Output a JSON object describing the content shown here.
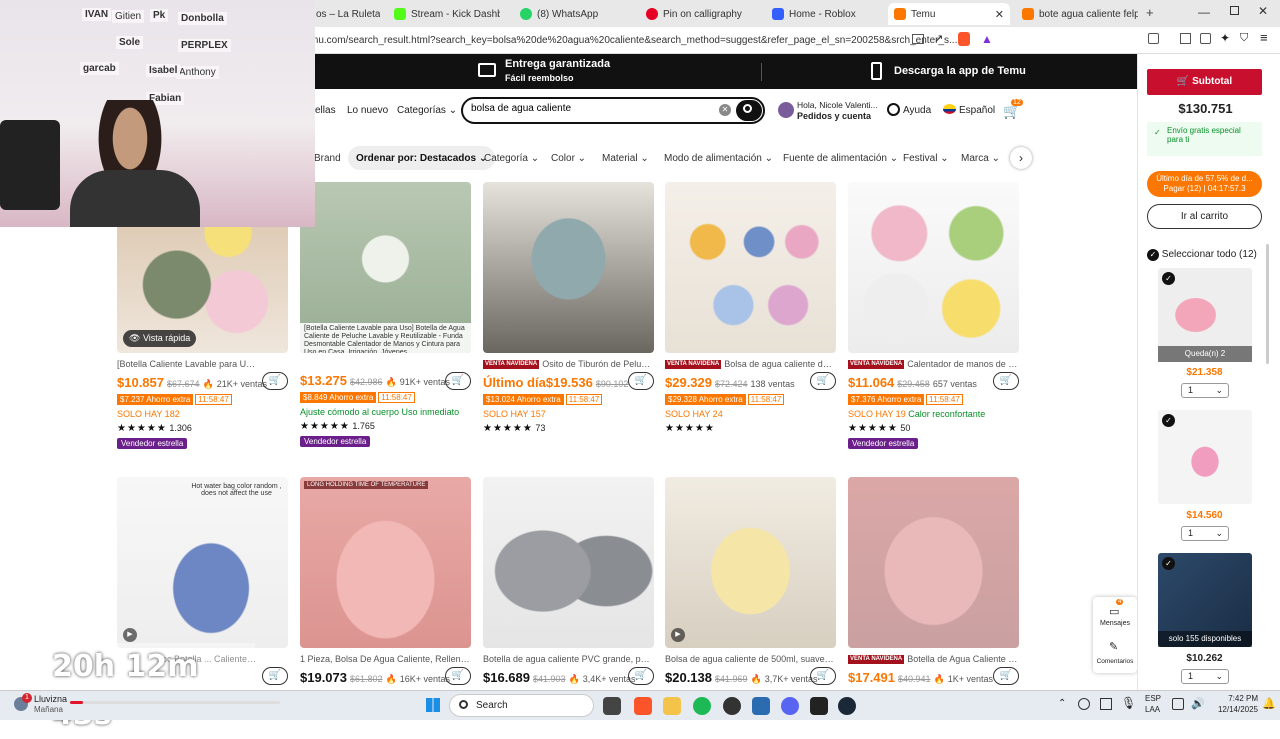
{
  "browser": {
    "tabs": [
      {
        "label": "os – La Ruleta de",
        "color": "#e54"
      },
      {
        "label": "Stream - Kick Dashbo",
        "color": "#53fc18"
      },
      {
        "label": "(8) WhatsApp",
        "color": "#25d366"
      },
      {
        "label": "Pin on calligraphy",
        "color": "#e60023"
      },
      {
        "label": "Home - Roblox",
        "color": "#335fff"
      },
      {
        "label": "Temu",
        "color": "#fb7701"
      },
      {
        "label": "bote agua caliente felpa S",
        "color": "#fb7701"
      }
    ],
    "url": "mu.com/search_result.html?search_key=bolsa%20de%20agua%20caliente&search_method=suggest&refer_page_el_sn=200258&srch_enter_s..."
  },
  "promo": {
    "guarantee_title": "Entrega garantizada",
    "guarantee_sub": "Fácil reembolso",
    "app": "Descarga la app de Temu"
  },
  "header": {
    "nav": [
      "ellas",
      "Lo nuevo",
      "Categorías"
    ],
    "search_value": "bolsa de agua caliente",
    "account_greeting": "Hola, Nicole Valenti...",
    "account_sub": "Pedidos y cuenta",
    "help": "Ayuda",
    "language": "Español",
    "cart_count": "12"
  },
  "filters": [
    "Brand",
    "Ordenar por: Destacados",
    "Categoría",
    "Color",
    "Material",
    "Modo de alimentación",
    "Fuente de alimentación",
    "Festival",
    "Marca"
  ],
  "quick_view": "Vista rápida",
  "products_row1": [
    {
      "title": "[Botella Caliente Lavable para Uso] Botella ...",
      "price": "10.857",
      "old": "$67.674",
      "sales": "21K+ ventas",
      "ahorro": "$7.237 Ahorro extra",
      "timer": "11:58:47",
      "stock": "SOLO HAY 182",
      "rating": "1.306",
      "badge": "Vendedor estrella"
    },
    {
      "title": "[Botella Caliente Lavable para Uso] Botella de Agua Caliente de Peluche Lavable y Reutilizable - Funda Desmontable Calentador de Manos y Cintura para Uso en Casa, Irrigación, Jóvenes",
      "price": "13.275",
      "old": "$42.986",
      "sales": "91K+ ventas",
      "ahorro": "$8.849 Ahorro extra",
      "timer": "11:58:47",
      "stock": "Ajuste cómodo al cuerpo Uso inmediato",
      "rating": "1.765",
      "badge": "Vendedor estrella"
    },
    {
      "title": "Osito de Tiburón de Peluche Bote...",
      "price_prefix": "Último día",
      "price": "19.536",
      "old": "$90.102",
      "sales": "",
      "ahorro": "$13.024 Ahorro extra",
      "timer": "11:58:47",
      "stock": "SOLO HAY 157",
      "rating": "73",
      "venta": "VENTA NAVIDEÑA"
    },
    {
      "title": "Bolsa de agua caliente de Disney ...",
      "price": "29.329",
      "old": "$72.424",
      "sales": "138 ventas",
      "ahorro": "$29.328 Ahorro extra",
      "timer": "11:58:47",
      "stock": "SOLO HAY 24",
      "rating": "",
      "venta": "VENTA NAVIDEÑA"
    },
    {
      "title": "Calentador de manos de bolsa de...",
      "price": "11.064",
      "old": "$29.458",
      "sales": "657 ventas",
      "ahorro": "$7.376 Ahorro extra",
      "timer": "11:58:47",
      "stock": "SOLO HAY 19",
      "stock_extra": "Calor reconfortante",
      "rating": "50",
      "badge": "Vendedor estrella",
      "venta": "VENTA NAVIDEÑA"
    }
  ],
  "products_row2": [
    {
      "title": "1pc Botella ... Caliente Stitc...",
      "price": "",
      "old": "",
      "sales": ""
    },
    {
      "title": "1 Pieza, Bolsa De Agua Caliente, Rellenar C...",
      "price": "19.073",
      "old": "$61.802",
      "sales": "16K+ ventas"
    },
    {
      "title": "Botella de agua caliente PVC grande, peluc...",
      "price": "16.689",
      "old": "$41.903",
      "sales": "3,4K+ ventas"
    },
    {
      "title": "Bolsa de agua caliente de 500ml, suave y e...",
      "price": "20.138",
      "old": "$41.969",
      "sales": "3,7K+ ventas"
    },
    {
      "title": "Botella de Agua Caliente de Gran ...",
      "price": "17.491",
      "old": "$40.941",
      "sales": "1K+ ventas",
      "venta": "VENTA NAVIDEÑA"
    }
  ],
  "image_captions": {
    "stitch": "Hot water bag color random , does not affect the use",
    "long_holding": "LONG HOLDING TIME OF TEMPERATURE"
  },
  "sidebar": {
    "subtotal_label": "Subtotal",
    "subtotal": "$130.751",
    "shipping": "Envío gratis especial para ti",
    "last_day": "Último día de 57,5% de d...",
    "pay": "Pagar (12) | 04:17:57.3",
    "go_cart": "Ir al carrito",
    "select_all": "Seleccionar todo (12)",
    "items": [
      {
        "price": "$21.358",
        "qty": "1",
        "tag": "Queda(n) 2"
      },
      {
        "price": "$14.560",
        "qty": "1",
        "tag": ""
      },
      {
        "price": "$10.262",
        "qty": "1",
        "tag": "solo 155 disponibles"
      }
    ],
    "messages": "Mensajes",
    "messages_count": "4",
    "comments": "Comentarios"
  },
  "overlay": {
    "stream_timer": "20h 12m 43s",
    "webcam_notes": [
      "IVAN",
      "Gitien",
      "Pk",
      "Donbolla",
      "Sole",
      "PERPLEX",
      "garcab",
      "Fabian",
      "Anthony",
      "Isabel"
    ]
  },
  "taskbar": {
    "weather": "Lluvizna",
    "weather_sub": "Mañana",
    "search": "Search",
    "lang": "ESP",
    "lang_sub": "LAA",
    "time": "7:42 PM",
    "date": "12/14/2025",
    "weather_badge": "1"
  },
  "colors": {
    "accent": "#fb7701",
    "dark": "#111111",
    "badge": "#6b1f8a",
    "christmas": "#a3121c"
  }
}
